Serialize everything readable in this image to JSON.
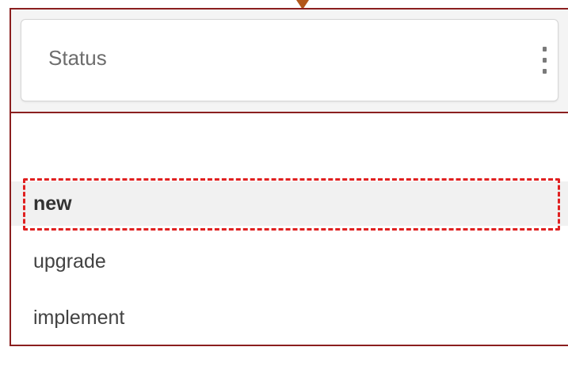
{
  "status_field": {
    "label": "Status",
    "menu_icon": "kebab-menu-icon"
  },
  "dropdown": {
    "options": [
      {
        "label": "new",
        "selected": true
      },
      {
        "label": "upgrade",
        "selected": false
      },
      {
        "label": "implement",
        "selected": false
      }
    ]
  },
  "colors": {
    "panel_border": "#8b1f1f",
    "highlight": "#e02020",
    "pointer": "#b2571a",
    "selected_bg": "#f1f1f1"
  }
}
